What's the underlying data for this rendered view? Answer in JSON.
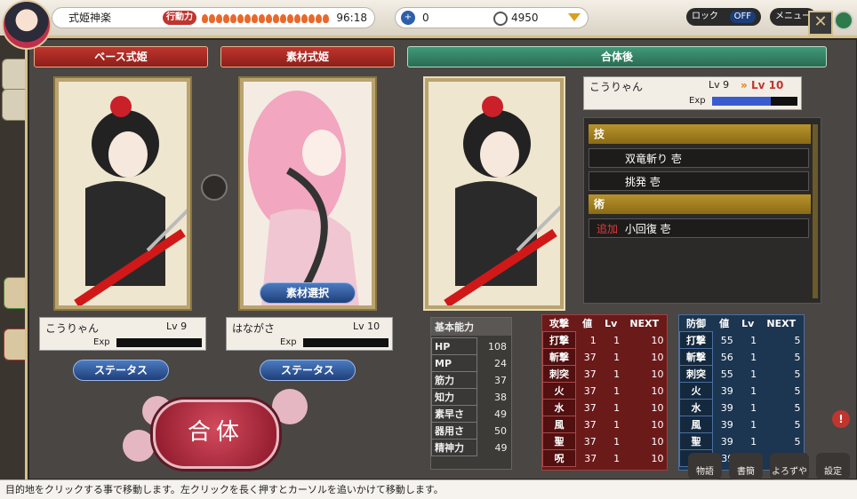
{
  "topbar": {
    "title": "式姫神楽",
    "stamina_label": "行動力",
    "stamina_value": "96:18",
    "counter_value": "0",
    "coin_value": "4950",
    "lock_label": "ロック",
    "lock_state": "OFF",
    "menu_label": "メニュー"
  },
  "headers": {
    "base": "ベース式姫",
    "material": "素材式姫",
    "result": "合体後"
  },
  "base_card": {
    "name": "こうりゃん",
    "level": "Lv 9",
    "exp_label": "Exp",
    "status_button": "ステータス"
  },
  "material_card": {
    "name": "はながさ",
    "level": "Lv 10",
    "exp_label": "Exp",
    "status_button": "ステータス",
    "select_button": "素材選択"
  },
  "result_card": {
    "name": "こうりゃん",
    "level_from": "Lv 9",
    "level_to": "Lv 10",
    "exp_label": "Exp"
  },
  "skills": {
    "waza_header": "技",
    "waza": [
      "双竜斬り 壱",
      "挑発 壱"
    ],
    "jutsu_header": "術",
    "jutsu": [
      {
        "tag": "追加",
        "name": "小回復 壱"
      }
    ]
  },
  "basic": {
    "header": "基本能力",
    "rows": [
      {
        "label": "HP",
        "value": "108"
      },
      {
        "label": "MP",
        "value": "24"
      },
      {
        "label": "筋力",
        "value": "37"
      },
      {
        "label": "知力",
        "value": "38"
      },
      {
        "label": "素早さ",
        "value": "49"
      },
      {
        "label": "器用さ",
        "value": "50"
      },
      {
        "label": "精神力",
        "value": "49"
      }
    ]
  },
  "attack": {
    "headers": [
      "攻撃",
      "値",
      "Lv",
      "NEXT"
    ],
    "rows": [
      [
        "打撃",
        "1",
        "1",
        "10"
      ],
      [
        "斬撃",
        "37",
        "1",
        "10"
      ],
      [
        "刺突",
        "37",
        "1",
        "10"
      ],
      [
        "火",
        "37",
        "1",
        "10"
      ],
      [
        "水",
        "37",
        "1",
        "10"
      ],
      [
        "風",
        "37",
        "1",
        "10"
      ],
      [
        "聖",
        "37",
        "1",
        "10"
      ],
      [
        "呪",
        "37",
        "1",
        "10"
      ]
    ]
  },
  "defense": {
    "headers": [
      "防御",
      "値",
      "Lv",
      "NEXT"
    ],
    "rows": [
      [
        "打撃",
        "55",
        "1",
        "5"
      ],
      [
        "斬撃",
        "56",
        "1",
        "5"
      ],
      [
        "刺突",
        "55",
        "1",
        "5"
      ],
      [
        "火",
        "39",
        "1",
        "5"
      ],
      [
        "水",
        "39",
        "1",
        "5"
      ],
      [
        "風",
        "39",
        "1",
        "5"
      ],
      [
        "聖",
        "39",
        "1",
        "5"
      ],
      [
        "呪",
        "39",
        "1",
        "5"
      ]
    ]
  },
  "fuse_button": "合体",
  "bottom_nav": [
    "物語",
    "書簡",
    "よろずや",
    "設定"
  ],
  "status_message": "目的地をクリックする事で移動します。左クリックを長く押すとカーソルを追いかけて移動します。",
  "colors": {
    "accent_red": "#c0352e",
    "accent_green": "#3f9a78",
    "gold": "#d6c08a"
  }
}
